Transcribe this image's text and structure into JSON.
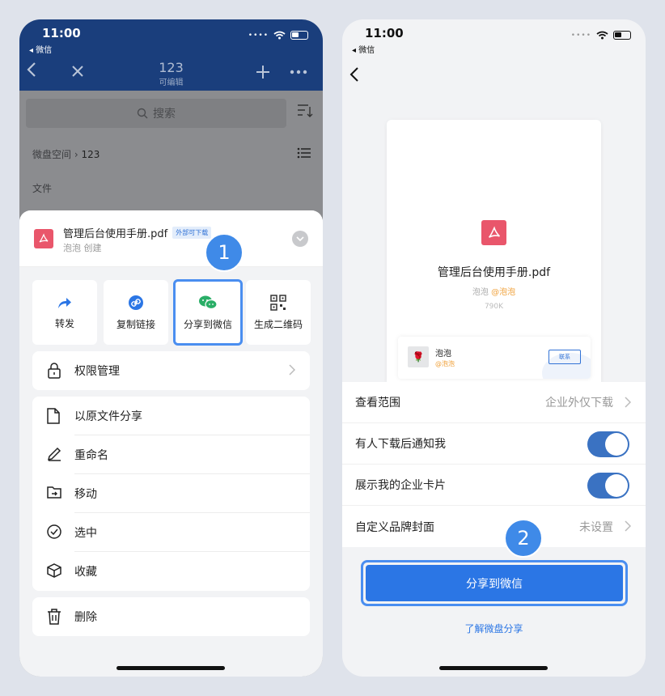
{
  "left": {
    "status": {
      "time": "11:00",
      "back_app": "◂ 微信"
    },
    "nav": {
      "title": "123",
      "subtitle": "可编辑"
    },
    "search": {
      "placeholder": "搜索"
    },
    "breadcrumb": {
      "root": "微盘空间",
      "current": "123"
    },
    "section_label": "文件",
    "file": {
      "name": "管理后台使用手册.pdf",
      "badge": "外部可下载",
      "meta": "泡泡 创建"
    },
    "step_badge": "1",
    "actions": [
      {
        "label": "转发"
      },
      {
        "label": "复制链接"
      },
      {
        "label": "分享到微信"
      },
      {
        "label": "生成二维码"
      }
    ],
    "permission": "权限管理",
    "menu": [
      {
        "label": "以原文件分享"
      },
      {
        "label": "重命名"
      },
      {
        "label": "移动"
      },
      {
        "label": "选中"
      },
      {
        "label": "收藏"
      }
    ],
    "delete": "删除"
  },
  "right": {
    "status": {
      "time": "11:00",
      "back_app": "◂ 微信"
    },
    "preview": {
      "file_name": "管理后台使用手册.pdf",
      "owner": "泡泡",
      "org": "@泡泡",
      "size": "790K",
      "card_name": "泡泡",
      "card_org": "@泡泡",
      "card_button": "联系"
    },
    "settings": [
      {
        "label": "查看范围",
        "value": "企业外仅下载"
      },
      {
        "label": "有人下载后通知我",
        "toggle": true
      },
      {
        "label": "展示我的企业卡片",
        "toggle": true
      },
      {
        "label": "自定义品牌封面",
        "value": "未设置"
      }
    ],
    "step_badge": "2",
    "share_button": "分享到微信",
    "learn_more": "了解微盘分享"
  },
  "colors": {
    "nav_bg": "#1a3e7c",
    "accent": "#2b76e5",
    "highlight": "#4a8ef0",
    "pdf": "#e9566b",
    "wechat": "#2aae67"
  }
}
